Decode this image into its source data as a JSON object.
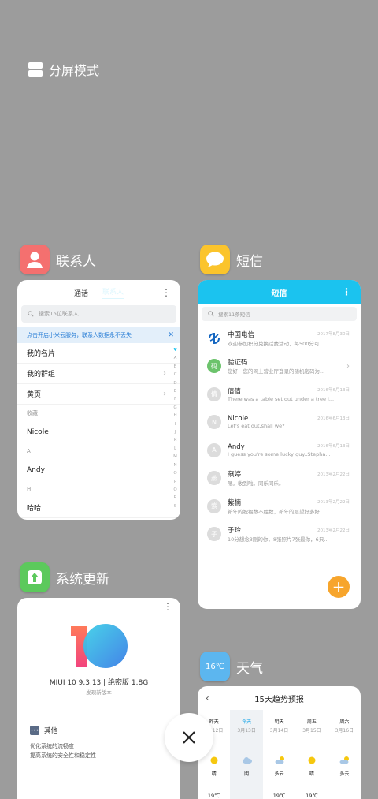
{
  "split_screen": {
    "label": "分屏模式"
  },
  "contacts": {
    "app_name": "联系人",
    "tab_left": "通话",
    "tab_right": "联系人",
    "search_placeholder": "搜索15位联系人",
    "banner": "点击开启小米云服务，联系人数据永不丢失",
    "items": [
      {
        "label": "我的名片",
        "kind": "item",
        "chevron": false
      },
      {
        "label": "我的群组",
        "kind": "item",
        "chevron": true
      },
      {
        "label": "黄页",
        "kind": "item",
        "chevron": true
      },
      {
        "label": "收藏",
        "kind": "head",
        "chevron": false
      },
      {
        "label": "Nicole",
        "kind": "item",
        "chevron": false
      },
      {
        "label": "A",
        "kind": "head",
        "chevron": false
      },
      {
        "label": "Andy",
        "kind": "item",
        "chevron": false
      },
      {
        "label": "H",
        "kind": "head",
        "chevron": false
      },
      {
        "label": "哈哈",
        "kind": "item",
        "chevron": false
      }
    ],
    "alphabet": [
      "♥",
      "A",
      "B",
      "C",
      "D",
      "E",
      "F",
      "G",
      "H",
      "I",
      "J",
      "K",
      "L",
      "M",
      "N",
      "O",
      "P",
      "Q",
      "R",
      "S"
    ]
  },
  "sms": {
    "app_name": "短信",
    "title": "短信",
    "search_placeholder": "搜索11条短信",
    "messages": [
      {
        "avatar": "",
        "name": "中国电信",
        "preview": "欢迎参加积分兑换话费活动，每500分可...",
        "time": "2017年8月30日",
        "color": "#1466c0"
      },
      {
        "avatar": "码",
        "name": "验证码",
        "preview": "您好！您的网上营业厅登录的随机密码为...",
        "time": "",
        "color": "#6cc36c"
      },
      {
        "avatar": "倩",
        "name": "倩倩",
        "preview": "There was a table set out under a tree i...",
        "time": "2016年6月13日",
        "color": "#dcdcdc"
      },
      {
        "avatar": "N",
        "name": "Nicole",
        "preview": "Let's eat out,shall we?",
        "time": "2016年6月13日",
        "color": "#dcdcdc"
      },
      {
        "avatar": "A",
        "name": "Andy",
        "preview": "I guess you're some lucky guy..Stepha...",
        "time": "2016年6月13日",
        "color": "#dcdcdc"
      },
      {
        "avatar": "燕",
        "name": "燕婷",
        "preview": "嗯。收到啦。同乐同乐。",
        "time": "2013年2月22日",
        "color": "#dcdcdc"
      },
      {
        "avatar": "紫",
        "name": "紫楠",
        "preview": "新年的祝福数不胜数，新年的愿望好多好...",
        "time": "2013年2月22日",
        "color": "#dcdcdc"
      },
      {
        "avatar": "子",
        "name": "子玲",
        "preview": "10分想念3刚的你，8张照片7张最你，6只...",
        "time": "2013年2月22日",
        "color": "#dcdcdc"
      }
    ],
    "fab": "+"
  },
  "updater": {
    "app_name": "系统更新",
    "version": "MIUI 10 9.3.13 | 绝密版 1.8G",
    "subtitle": "发现新版本",
    "section": "其他",
    "desc_1": "优化系统的流畅度",
    "desc_2": "提高系统的安全性和稳定性"
  },
  "weather": {
    "app_name": "天气",
    "icon_temp": "16℃",
    "title": "15天趋势预报",
    "days": [
      {
        "day": "昨天",
        "date": "3月12日",
        "cond": "晴",
        "temp": "19℃",
        "icon": "sun",
        "today": false
      },
      {
        "day": "今天",
        "date": "3月13日",
        "cond": "阴",
        "temp": "",
        "icon": "cloud",
        "today": true
      },
      {
        "day": "明天",
        "date": "3月14日",
        "cond": "多云",
        "temp": "19℃",
        "icon": "partly",
        "today": false
      },
      {
        "day": "周五",
        "date": "3月15日",
        "cond": "晴",
        "temp": "19℃",
        "icon": "sun",
        "today": false
      },
      {
        "day": "周六",
        "date": "3月16日",
        "cond": "多云",
        "temp": "",
        "icon": "partly",
        "today": false
      }
    ]
  },
  "colors": {
    "sms_header": "#1bc3ef",
    "fab": "#f7a52c",
    "accent_blue": "#2b7fd6",
    "today_blue": "#1ba6e8"
  }
}
